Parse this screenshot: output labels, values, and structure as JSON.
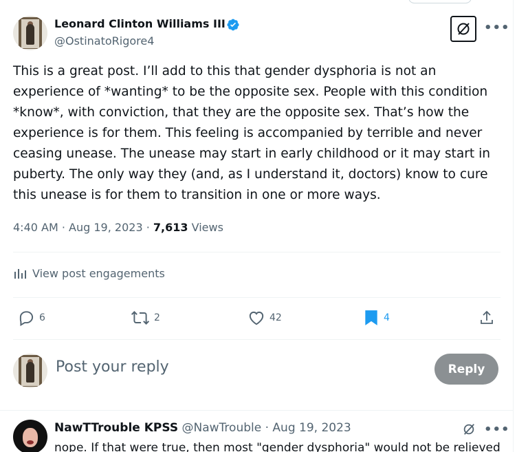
{
  "post": {
    "author_name": "Leonard Clinton Williams III",
    "author_handle": "@OstinatoRigore4",
    "text": "This is a great post. I’ll add to this that gender dysphoria is not an experience of *wanting* to be the opposite sex. People with this condition *know*, with conviction, that they are the opposite sex. That’s how the experience is for them. This feeling is accompanied by terrible and never ceasing unease. The unease may start in early childhood or it may start in puberty. The only way they (and, as I understand it, doctors) know to cure this unease is for them to transition in one or more ways.",
    "time": "4:40 AM",
    "date": "Aug 19, 2023",
    "views_count": "7,613",
    "views_label": "Views",
    "separator": "·",
    "more_label": "•••"
  },
  "engagements": {
    "label": "View post engagements",
    "icon": "analytics-icon"
  },
  "actions": {
    "replies": "6",
    "reposts": "2",
    "likes": "42",
    "bookmarks": "4"
  },
  "composer": {
    "placeholder": "Post your reply",
    "button_label": "Reply"
  },
  "reply": {
    "author_name": "NawTTrouble KPSS",
    "author_handle": "@NawTrouble",
    "date": "Aug 19, 2023",
    "separator": "·",
    "text": "nope. If that were true, then most \"gender dysphoria\" would not be relieved",
    "more_label": "•••"
  },
  "colors": {
    "accent": "#1d9bf0",
    "text": "#0f1419",
    "secondary": "#536471",
    "reply_button": "#8b9093"
  }
}
